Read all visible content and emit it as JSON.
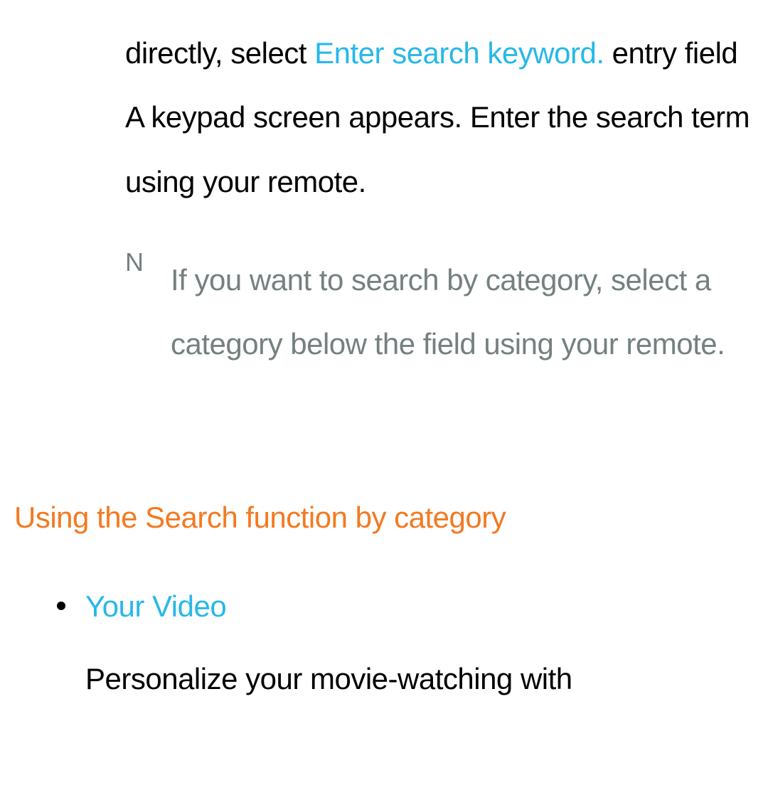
{
  "paragraph": {
    "part1": "directly, select ",
    "highlight": "Enter search keyword.",
    "part2": " entry field A keypad screen appears. Enter the search term using your remote."
  },
  "note": {
    "marker": "N",
    "text": "If you want to search by category, select a category below the field using your remote."
  },
  "section": {
    "heading": "Using the Search function by category"
  },
  "bullet": {
    "title": "Your Video",
    "description": "Personalize your movie-watching with"
  }
}
